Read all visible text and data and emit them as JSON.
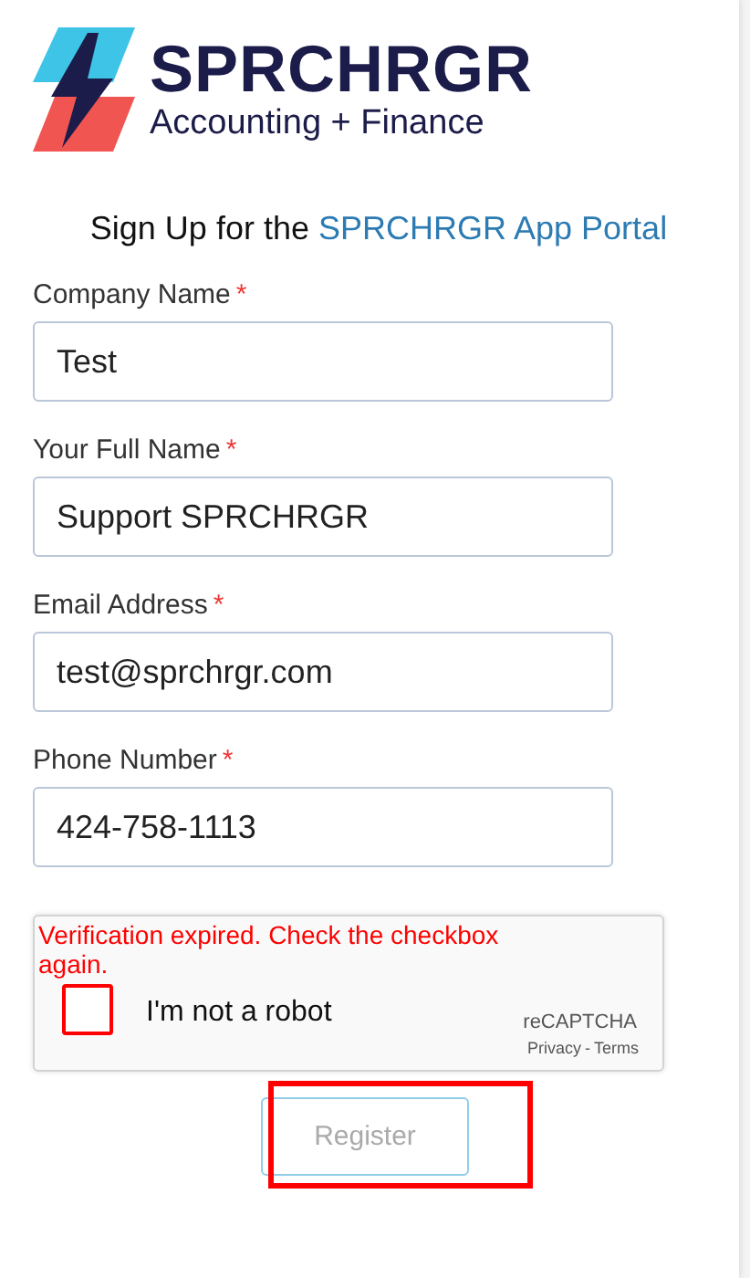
{
  "logo": {
    "name": "SPRCHRGR",
    "tagline": "Accounting + Finance"
  },
  "heading": {
    "text": "Sign Up for the",
    "accent": "SPRCHRGR App Portal"
  },
  "fields": [
    {
      "label": "Company Name",
      "required_mark": "*",
      "value": "Test"
    },
    {
      "label": "Your Full Name",
      "required_mark": "*",
      "value": "Support SPRCHRGR"
    },
    {
      "label": "Email Address",
      "required_mark": "*",
      "value": "test@sprchrgr.com"
    },
    {
      "label": "Phone Number",
      "required_mark": "*",
      "value": "424-758-1113"
    }
  ],
  "captcha": {
    "error": "Verification expired. Check the checkbox again.",
    "label": "I'm not a robot",
    "checked": false,
    "brand": "reCAPTCHA",
    "privacy": "Privacy",
    "separator": "-",
    "terms": "Terms"
  },
  "register": {
    "label": "Register",
    "disabled": true,
    "highlighted": true
  }
}
